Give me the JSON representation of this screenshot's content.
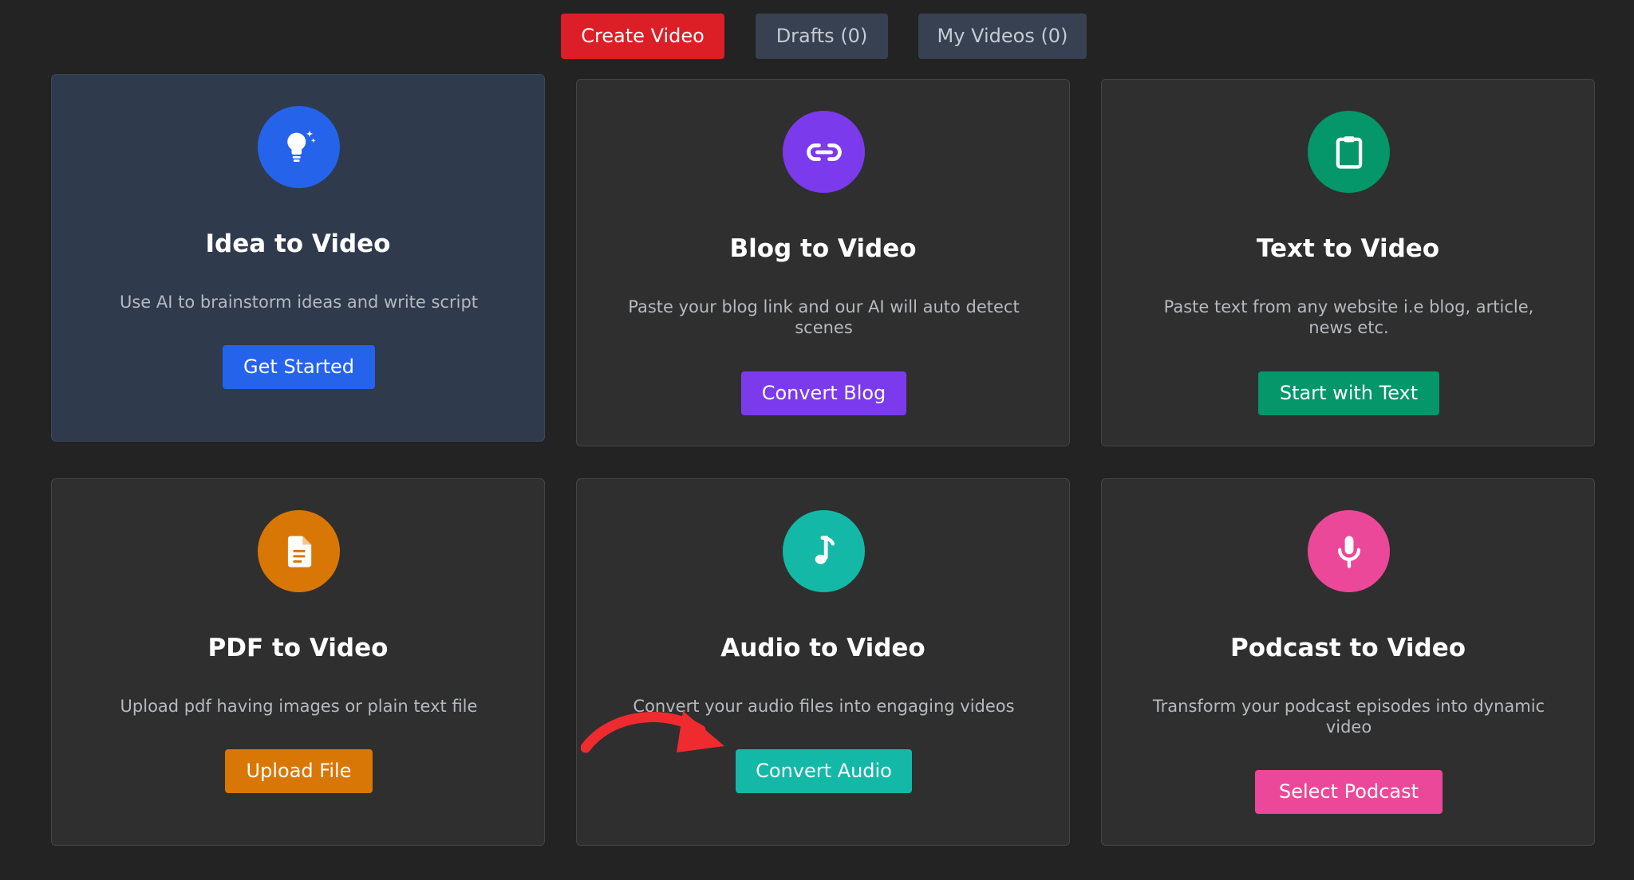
{
  "tabs": {
    "create": "Create Video",
    "drafts": "Drafts (0)",
    "my_videos": "My Videos (0)"
  },
  "colors": {
    "page_bg": "#232323",
    "card_bg": "#2f2f2f",
    "card_highlight_bg": "#2f3a4d",
    "create_tab": "#dc1f26",
    "inactive_tab": "#374151",
    "blue": "#2563eb",
    "purple": "#7c3aed",
    "green": "#059669",
    "orange": "#d97706",
    "teal": "#14b8a6",
    "pink": "#ec4899",
    "annotation_arrow": "#ef2b2f"
  },
  "cards": [
    {
      "title": "Idea to Video",
      "description": "Use AI to brainstorm ideas and write script",
      "button": "Get Started",
      "icon": "lightbulb-sparkle-icon",
      "color": "#2563eb",
      "highlighted": true
    },
    {
      "title": "Blog to Video",
      "description": "Paste your blog link and our AI will auto detect scenes",
      "button": "Convert Blog",
      "icon": "link-icon",
      "color": "#7c3aed"
    },
    {
      "title": "Text to Video",
      "description": "Paste text from any website i.e blog, article, news etc.",
      "button": "Start with Text",
      "icon": "clipboard-icon",
      "color": "#059669"
    },
    {
      "title": "PDF to Video",
      "description": "Upload pdf having images or plain text file",
      "button": "Upload File",
      "icon": "document-icon",
      "color": "#d97706"
    },
    {
      "title": "Audio to Video",
      "description": "Convert your audio files into engaging videos",
      "button": "Convert Audio",
      "icon": "music-note-icon",
      "color": "#14b8a6"
    },
    {
      "title": "Podcast to Video",
      "description": "Transform your podcast episodes into dynamic video",
      "button": "Select Podcast",
      "icon": "microphone-icon",
      "color": "#ec4899"
    }
  ]
}
